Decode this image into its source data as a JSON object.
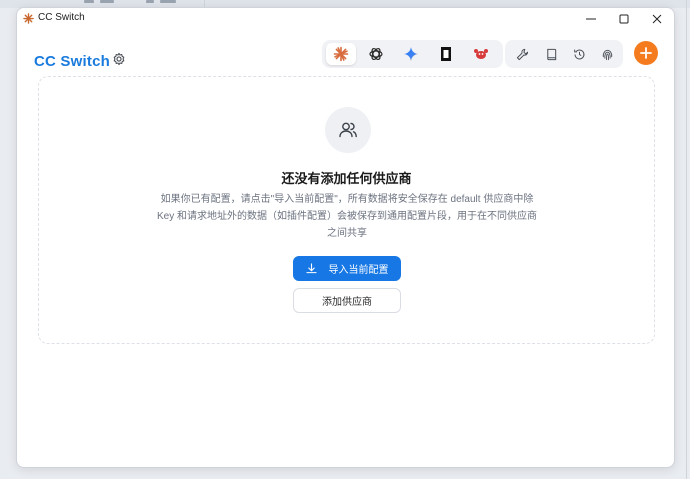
{
  "window": {
    "title": "CC Switch"
  },
  "header": {
    "app_title": "CC Switch",
    "apps": [
      {
        "name": "claude",
        "icon": "claude-icon",
        "active": true
      },
      {
        "name": "openai",
        "icon": "openai-icon",
        "active": false
      },
      {
        "name": "gemini",
        "icon": "gemini-icon",
        "active": false
      },
      {
        "name": "opencode",
        "icon": "opencode-icon",
        "active": false
      },
      {
        "name": "crab",
        "icon": "crab-icon",
        "active": false
      }
    ],
    "tools": [
      {
        "icon": "wrench-icon"
      },
      {
        "icon": "book-icon"
      },
      {
        "icon": "history-icon"
      },
      {
        "icon": "fingerprint-icon"
      }
    ]
  },
  "empty_state": {
    "title": "还没有添加任何供应商",
    "description": "如果你已有配置，请点击\"导入当前配置\"，所有数据将安全保存在 default 供应商中除 Key 和请求地址外的数据（如插件配置）会被保存到通用配置片段，用于在不同供应商之间共享",
    "import_label": "导入当前配置",
    "add_label": "添加供应商"
  },
  "colors": {
    "accent": "#1677e5",
    "title": "#1a7bde",
    "add": "#f47c1e"
  }
}
